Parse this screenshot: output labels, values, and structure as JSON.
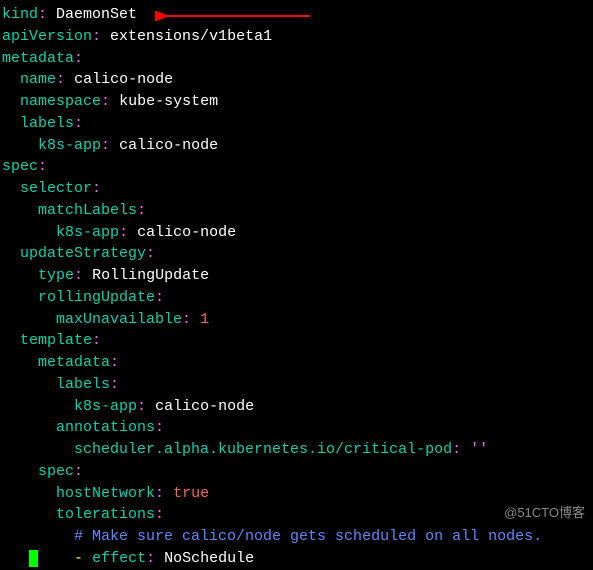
{
  "lines": {
    "l01_k": "kind",
    "l01_v": "DaemonSet",
    "l02_k": "apiVersion",
    "l02_v": "extensions/v1beta1",
    "l03_k": "metadata",
    "l04_k": "name",
    "l04_v": "calico-node",
    "l05_k": "namespace",
    "l05_v": "kube-system",
    "l06_k": "labels",
    "l07_k": "k8s-app",
    "l07_v": "calico-node",
    "l08_k": "spec",
    "l09_k": "selector",
    "l10_k": "matchLabels",
    "l11_k": "k8s-app",
    "l11_v": "calico-node",
    "l12_k": "updateStrategy",
    "l13_k": "type",
    "l13_v": "RollingUpdate",
    "l14_k": "rollingUpdate",
    "l15_k": "maxUnavailable",
    "l15_v": "1",
    "l16_k": "template",
    "l17_k": "metadata",
    "l18_k": "labels",
    "l19_k": "k8s-app",
    "l19_v": "calico-node",
    "l20_k": "annotations",
    "l21_k": "scheduler.alpha.kubernetes.io/critical-pod",
    "l21_v": "''",
    "l22_k": "spec",
    "l23_k": "hostNetwork",
    "l23_v": "true",
    "l24_k": "tolerations",
    "l25_c": "# Make sure calico/node gets scheduled on all nodes.",
    "l26_k": "effect",
    "l26_v": "NoSchedule"
  },
  "colon": ":",
  "dash": "-",
  "watermark": "@51CTO博客"
}
